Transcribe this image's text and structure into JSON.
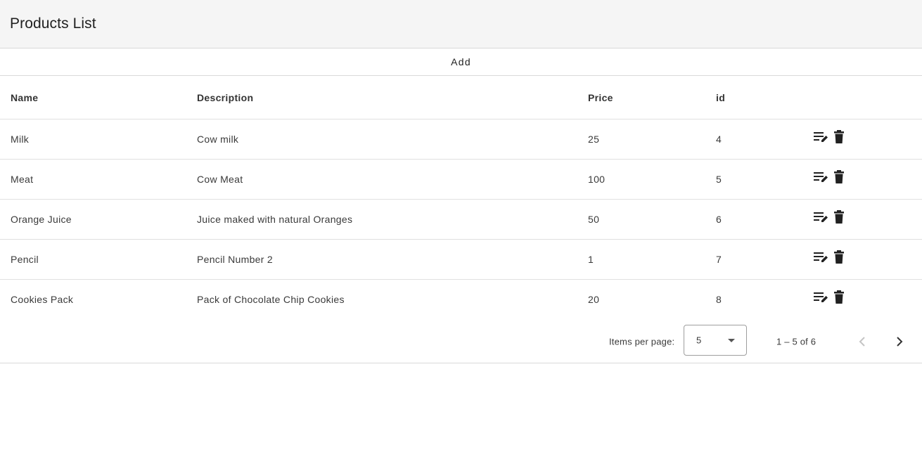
{
  "toolbar": {
    "title": "Products List"
  },
  "actions": {
    "add_label": "Add"
  },
  "table": {
    "headers": {
      "name": "Name",
      "description": "Description",
      "price": "Price",
      "id": "id"
    },
    "rows": [
      {
        "name": "Milk",
        "description": "Cow milk",
        "price": "25",
        "id": "4"
      },
      {
        "name": "Meat",
        "description": "Cow Meat",
        "price": "100",
        "id": "5"
      },
      {
        "name": "Orange Juice",
        "description": "Juice maked with natural Oranges",
        "price": "50",
        "id": "6"
      },
      {
        "name": "Pencil",
        "description": "Pencil Number 2",
        "price": "1",
        "id": "7"
      },
      {
        "name": "Cookies Pack",
        "description": "Pack of Chocolate Chip Cookies",
        "price": "20",
        "id": "8"
      }
    ],
    "row_icons": {
      "edit": "edit-note-icon",
      "delete": "trash-icon"
    }
  },
  "paginator": {
    "items_per_page_label": "Items per page:",
    "page_size": "5",
    "range_label": "1 – 5 of 6",
    "prev_icon": "chevron-left-icon",
    "next_icon": "chevron-right-icon"
  },
  "colors": {
    "toolbar_bg": "#f5f5f5",
    "text": "#212121",
    "divider": "#e0e0e0",
    "icon": "#212121",
    "disabled_icon": "#c4c4c4"
  }
}
